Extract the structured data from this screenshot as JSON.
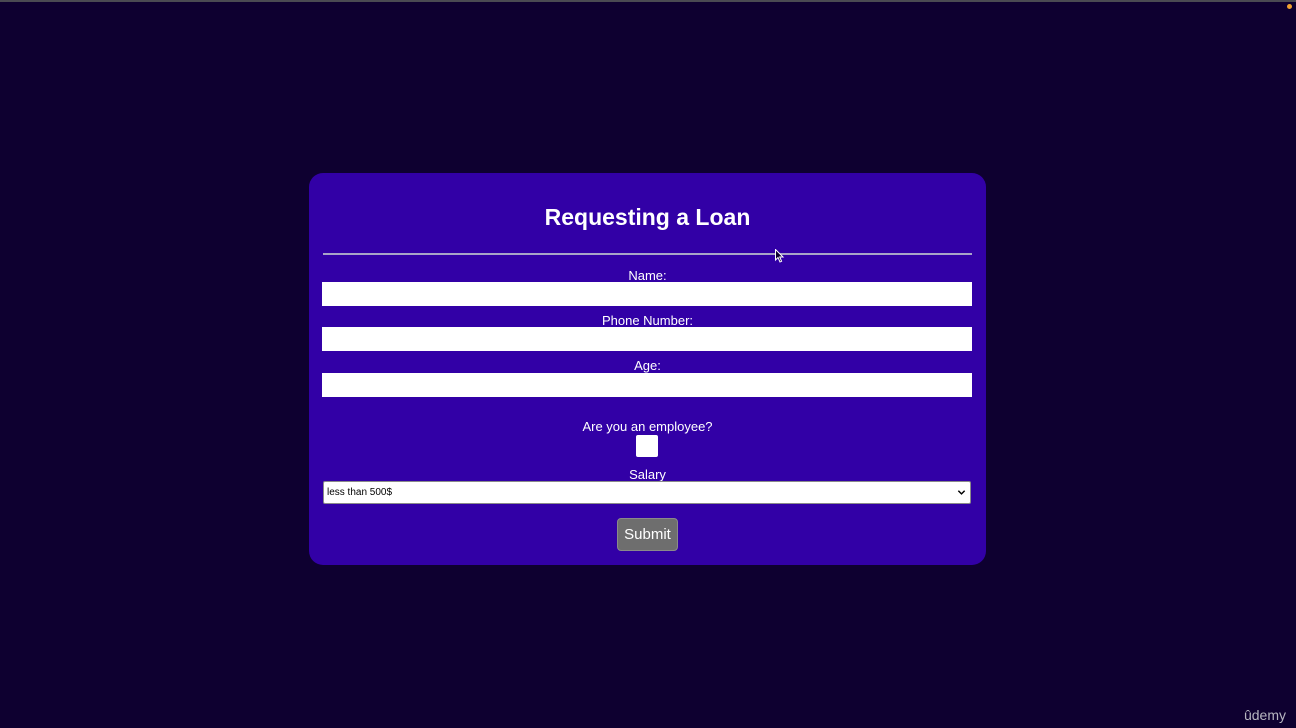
{
  "form": {
    "title": "Requesting a Loan",
    "name_label": "Name:",
    "name_value": "",
    "phone_label": "Phone Number:",
    "phone_value": "",
    "age_label": "Age:",
    "age_value": "",
    "employee_label": "Are you an employee?",
    "employee_checked": false,
    "salary_label": "Salary",
    "salary_selected": "less than 500$",
    "submit_label": "Submit"
  },
  "watermark": {
    "text": "ûdemy"
  },
  "colors": {
    "page_background": "#0e0030",
    "card_background": "#3200a6",
    "submit_background": "#6e6e6e",
    "text": "#ffffff"
  },
  "icons": {
    "select": "chevron-down-icon",
    "cursor": "mouse-pointer-icon"
  }
}
